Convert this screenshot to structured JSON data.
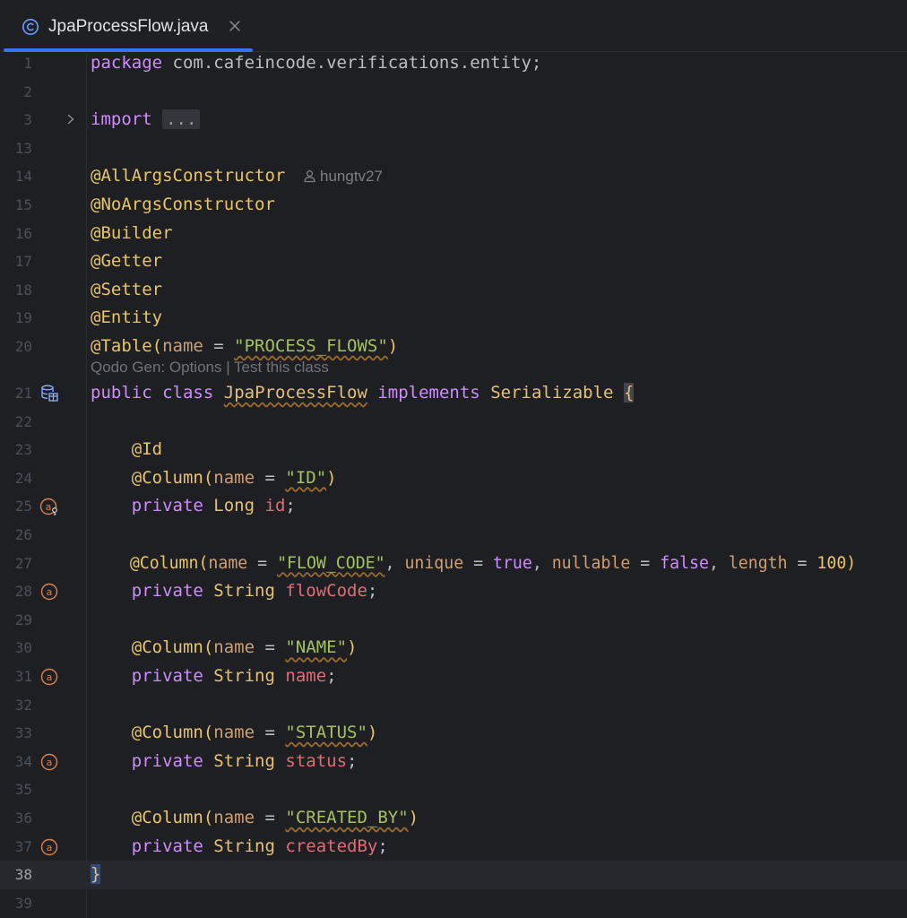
{
  "tab": {
    "title": "JpaProcessFlow.java",
    "icon": "class-icon",
    "accent": "#3574f0"
  },
  "inlay_author": "hungtv27",
  "codelens": {
    "options": "Qodo Gen: Options",
    "separator": " | ",
    "test": "Test this class"
  },
  "lines": [
    {
      "n": "1"
    },
    {
      "n": "2"
    },
    {
      "n": "3"
    },
    {
      "n": "13"
    },
    {
      "n": "14"
    },
    {
      "n": "15"
    },
    {
      "n": "16"
    },
    {
      "n": "17"
    },
    {
      "n": "18"
    },
    {
      "n": "19"
    },
    {
      "n": "20"
    },
    {
      "n": "21"
    },
    {
      "n": "22"
    },
    {
      "n": "23"
    },
    {
      "n": "24"
    },
    {
      "n": "25"
    },
    {
      "n": "26"
    },
    {
      "n": "27"
    },
    {
      "n": "28"
    },
    {
      "n": "29"
    },
    {
      "n": "30"
    },
    {
      "n": "31"
    },
    {
      "n": "32"
    },
    {
      "n": "33"
    },
    {
      "n": "34"
    },
    {
      "n": "35"
    },
    {
      "n": "36"
    },
    {
      "n": "37"
    },
    {
      "n": "38"
    },
    {
      "n": "39"
    }
  ],
  "code": {
    "l1_kw": "package",
    "l1_rest": " com.cafeincode.verifications.entity;",
    "l3_kw": "import",
    "l3_fold": "...",
    "l14": "@AllArgsConstructor",
    "l15": "@NoArgsConstructor",
    "l16": "@Builder",
    "l17": "@Getter",
    "l18": "@Setter",
    "l19": "@Entity",
    "l20_ann": "@Table(",
    "l20_param": "name",
    "l20_eq": " = ",
    "l20_str": "\"PROCESS_FLOWS\"",
    "l20_end": ")",
    "l21_kw1": "public",
    "l21_kw2": "class",
    "l21_cls": "JpaProcessFlow",
    "l21_kw3": "implements",
    "l21_iface": "Serializable",
    "l21_brace": "{",
    "l23": "@Id",
    "l24_ann": "@Column(",
    "l24_param": "name",
    "l24_eq": " = ",
    "l24_str": "\"ID\"",
    "l24_end": ")",
    "l25_kw": "private",
    "l25_type": "Long",
    "l25_fld": "id",
    "l25_end": ";",
    "l27_ann": "@Column(",
    "l27_p1": "name",
    "l27_eq1": " = ",
    "l27_str": "\"FLOW_CODE\"",
    "l27_c1": ", ",
    "l27_p2": "unique",
    "l27_eq2": " = ",
    "l27_v2": "true",
    "l27_c2": ", ",
    "l27_p3": "nullable",
    "l27_eq3": " = ",
    "l27_v3": "false",
    "l27_c3": ", ",
    "l27_p4": "length",
    "l27_eq4": " = ",
    "l27_v4": "100",
    "l27_end": ")",
    "l28_kw": "private",
    "l28_type": "String",
    "l28_fld": "flowCode",
    "l28_end": ";",
    "l30_ann": "@Column(",
    "l30_param": "name",
    "l30_eq": " = ",
    "l30_str": "\"NAME\"",
    "l30_end": ")",
    "l31_kw": "private",
    "l31_type": "String",
    "l31_fld": "name",
    "l31_end": ";",
    "l33_ann": "@Column(",
    "l33_param": "name",
    "l33_eq": " = ",
    "l33_str": "\"STATUS\"",
    "l33_end": ")",
    "l34_kw": "private",
    "l34_type": "String",
    "l34_fld": "status",
    "l34_end": ";",
    "l36_ann": "@Column(",
    "l36_param": "name",
    "l36_eq": " = ",
    "l36_str": "\"CREATED_BY\"",
    "l36_end": ")",
    "l37_kw": "private",
    "l37_type": "String",
    "l37_fld": "createdBy",
    "l37_end": ";",
    "l38": "}"
  },
  "colors": {
    "keyword": "#cf8dfb",
    "annotation": "#e8c46a",
    "string": "#a5c261",
    "field": "#e06c75",
    "gutter_icon": "#d9824a"
  },
  "current_line": "38"
}
